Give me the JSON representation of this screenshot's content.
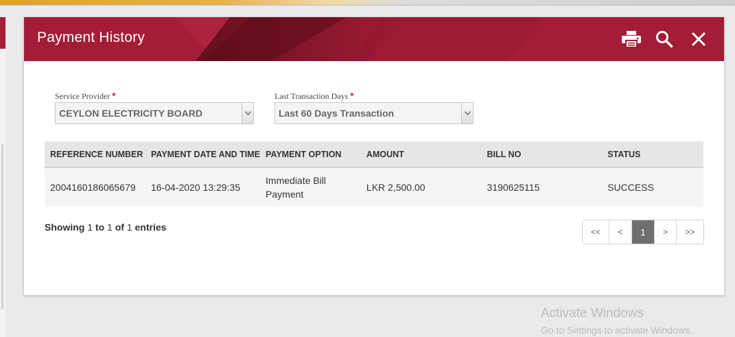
{
  "modal": {
    "title": "Payment History",
    "icons": [
      "print-icon",
      "search-icon",
      "close-icon"
    ],
    "header_color": "#a31d37"
  },
  "filters": {
    "service_provider": {
      "label": "Service Provider",
      "required_mark": "*",
      "value": "CEYLON ELECTRICITY BOARD"
    },
    "transaction_days": {
      "label": "Last Transaction Days",
      "required_mark": "*",
      "value": "Last 60 Days Transaction"
    }
  },
  "table": {
    "headers": [
      "REFERENCE NUMBER",
      "PAYMENT DATE AND TIME",
      "PAYMENT OPTION",
      "AMOUNT",
      "BILL NO",
      "STATUS"
    ],
    "rows": [
      [
        "2004160186065679",
        "16-04-2020 13:29:35",
        "Immediate Bill Payment",
        "LKR 2,500.00",
        "3190625115",
        "SUCCESS"
      ]
    ]
  },
  "footer": {
    "showing": "Showing",
    "from": "1",
    "to_word": "to",
    "to": "1",
    "of_word": "of",
    "total": "1",
    "entries": "entries"
  },
  "pagination": {
    "first": "<<",
    "prev": "<",
    "current": "1",
    "next": ">",
    "last": ">>"
  },
  "watermark": {
    "title": "Activate Windows",
    "subtitle": "Go to Settings to activate Windows."
  }
}
